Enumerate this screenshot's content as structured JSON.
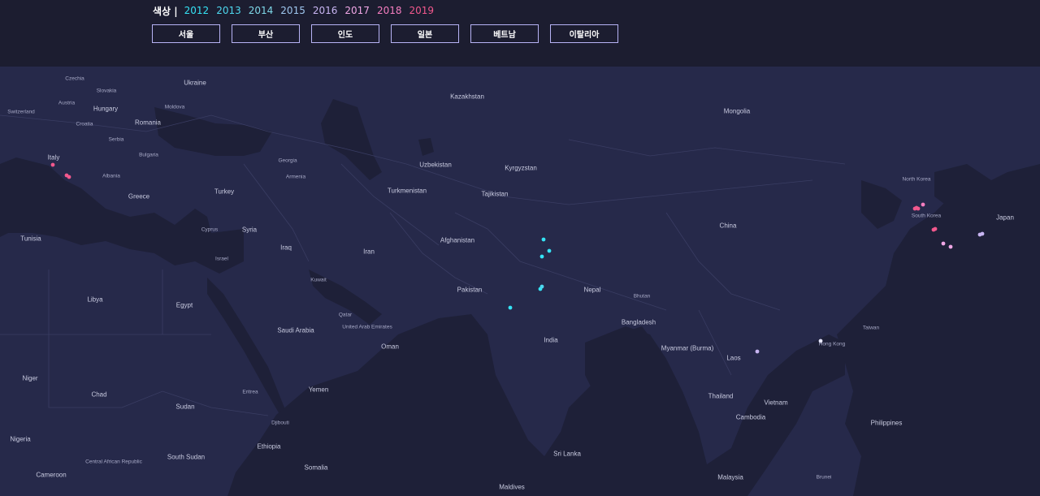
{
  "legend": {
    "label": "색상 |",
    "years": [
      {
        "label": "2012",
        "color": "#35e3f5"
      },
      {
        "label": "2013",
        "color": "#4ed8ef"
      },
      {
        "label": "2014",
        "color": "#7fd8e8"
      },
      {
        "label": "2015",
        "color": "#9fc7ef"
      },
      {
        "label": "2016",
        "color": "#c8b5f2"
      },
      {
        "label": "2017",
        "color": "#f0a7e6"
      },
      {
        "label": "2018",
        "color": "#f57ec0"
      },
      {
        "label": "2019",
        "color": "#f2588d"
      }
    ]
  },
  "buttons": [
    "서울",
    "부산",
    "인도",
    "일본",
    "베트남",
    "이탈리아"
  ],
  "map": {
    "country_labels": [
      "Czechia",
      "Slovakia",
      "Ukraine",
      "Austria",
      "Hungary",
      "Moldova",
      "Switzerland",
      "Croatia",
      "Romania",
      "Serbia",
      "Bulgaria",
      "Italy",
      "Albania",
      "Greece",
      "Turkey",
      "Georgia",
      "Armenia",
      "Kazakhstan",
      "Mongolia",
      "Uzbekistan",
      "Kyrgyzstan",
      "Turkmenistan",
      "Tajikistan",
      "North Korea",
      "South Korea",
      "Japan",
      "Tunisia",
      "Cyprus",
      "Syria",
      "Israel",
      "Iraq",
      "Iran",
      "Afghanistan",
      "China",
      "Libya",
      "Egypt",
      "Kuwait",
      "Pakistan",
      "Nepal",
      "Bhutan",
      "Qatar",
      "United Arab Emirates",
      "Saudi Arabia",
      "Bangladesh",
      "India",
      "Oman",
      "Myanmar (Burma)",
      "Laos",
      "Hong Kong",
      "Taiwan",
      "Niger",
      "Chad",
      "Sudan",
      "Eritrea",
      "Yemen",
      "Thailand",
      "Vietnam",
      "Djibouti",
      "Cambodia",
      "Philippines",
      "Nigeria",
      "Ethiopia",
      "Central African Republic",
      "South Sudan",
      "Sri Lanka",
      "Somalia",
      "Cameroon",
      "Maldives",
      "Malaysia",
      "Brunei"
    ]
  }
}
